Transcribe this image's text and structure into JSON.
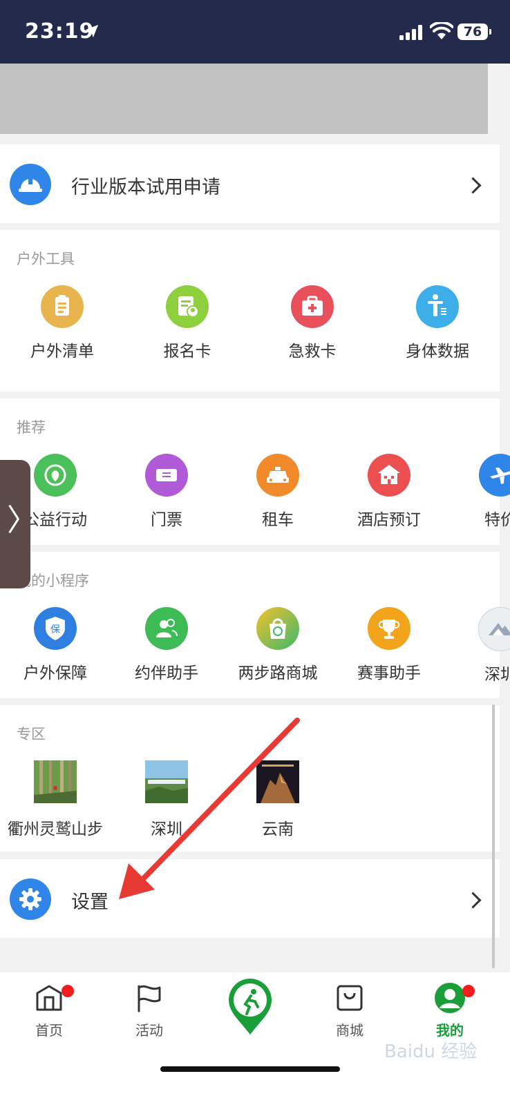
{
  "status_bar": {
    "time": "23:19",
    "battery": "76"
  },
  "industry_row": {
    "label": "行业版本试用申请"
  },
  "outdoor_tools": {
    "title": "户外工具",
    "items": [
      {
        "label": "户外清单",
        "icon": "clipboard-icon",
        "color": "#e8b44d"
      },
      {
        "label": "报名卡",
        "icon": "registration-card-icon",
        "color": "#8ecf3d"
      },
      {
        "label": "急救卡",
        "icon": "first-aid-kit-icon",
        "color": "#e8505b"
      },
      {
        "label": "身体数据",
        "icon": "body-data-icon",
        "color": "#3eaee8"
      }
    ]
  },
  "recommend": {
    "title": "推荐",
    "items": [
      {
        "label": "公益行动",
        "icon": "charity-icon",
        "color": "#4cc05a"
      },
      {
        "label": "门票",
        "icon": "ticket-icon",
        "color": "#b05ad8"
      },
      {
        "label": "租车",
        "icon": "car-icon",
        "color": "#f08a2a"
      },
      {
        "label": "酒店预订",
        "icon": "hotel-icon",
        "color": "#ec4f4f"
      },
      {
        "label": "特价",
        "icon": "plane-icon",
        "color": "#2f86e8"
      }
    ]
  },
  "mini_programs": {
    "title": "我的小程序",
    "items": [
      {
        "label": "户外保障",
        "icon": "insurance-shield-icon",
        "color": "#2f7fe0"
      },
      {
        "label": "约伴助手",
        "icon": "companion-icon",
        "color": "#3dbb55"
      },
      {
        "label": "两步路商城",
        "icon": "shop-bag-icon",
        "color": "#7bc84a"
      },
      {
        "label": "赛事助手",
        "icon": "trophy-icon",
        "color": "#f1a41c"
      },
      {
        "label": "深圳",
        "icon": "shenzhen-logo-icon",
        "color": "#9aa7b8"
      }
    ]
  },
  "zones": {
    "title": "专区",
    "items": [
      {
        "label": "衢州灵鹫山步"
      },
      {
        "label": "深圳"
      },
      {
        "label": "云南"
      }
    ]
  },
  "settings_row": {
    "label": "设置"
  },
  "tabbar": {
    "items": [
      {
        "label": "首页",
        "icon": "home-icon"
      },
      {
        "label": "活动",
        "icon": "flag-icon"
      },
      {
        "label": "",
        "icon": "twostep-logo-icon"
      },
      {
        "label": "商城",
        "icon": "shopping-bag-icon"
      },
      {
        "label": "我的",
        "icon": "profile-icon"
      }
    ],
    "active_color": "#1a9e3a"
  },
  "watermark": "Baidu 经验"
}
